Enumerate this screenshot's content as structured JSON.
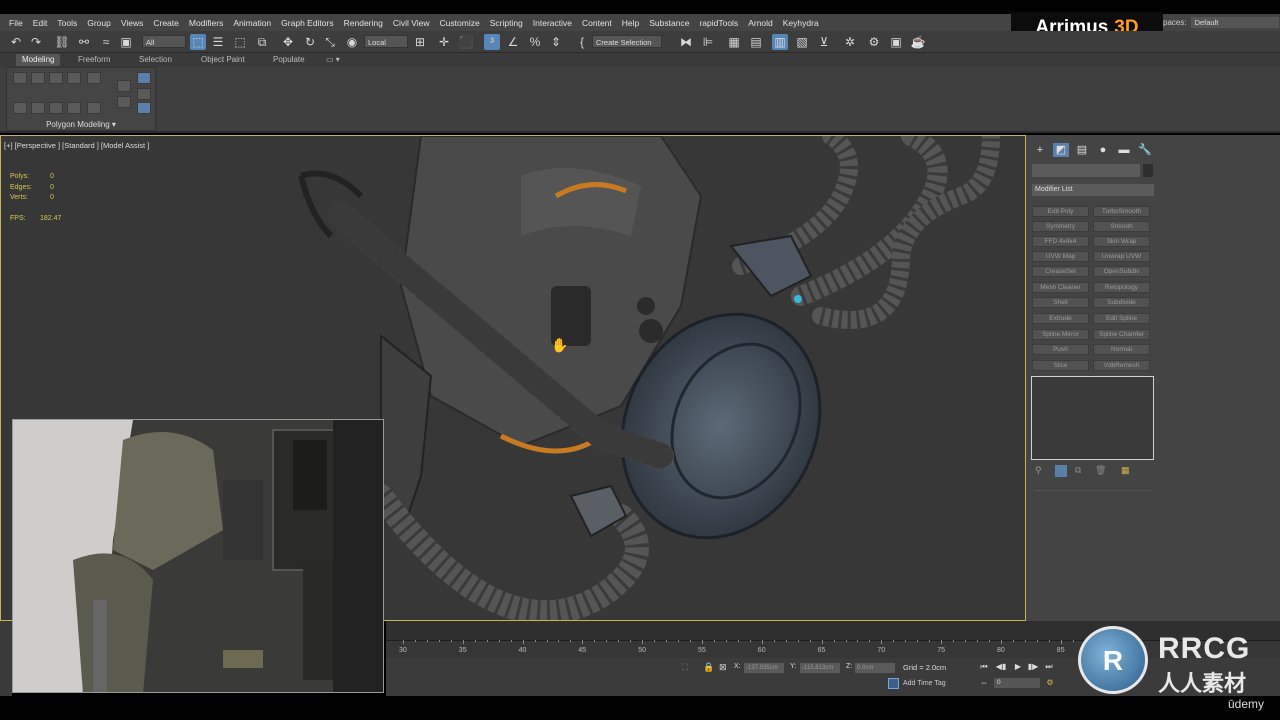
{
  "menu": [
    "File",
    "Edit",
    "Tools",
    "Group",
    "Views",
    "Create",
    "Modifiers",
    "Animation",
    "Graph Editors",
    "Rendering",
    "Civil View",
    "Customize",
    "Scripting",
    "Interactive",
    "Content",
    "Help",
    "Substance",
    "rapidTools",
    "Arnold",
    "Keyhydra"
  ],
  "brand": {
    "part1": "Arrimus",
    "part2": "3D"
  },
  "workspace": {
    "label": "paces:",
    "value": "Default"
  },
  "toolbar": {
    "filter": "All",
    "coord": "Local",
    "selection_set": "Create Selection Se"
  },
  "ribbon": {
    "tabs": [
      "Modeling",
      "Freeform",
      "Selection",
      "Object Paint",
      "Populate"
    ],
    "panel_label": "Polygon Modeling ▾"
  },
  "viewport": {
    "label": "[+] [Perspective ] [Standard ] [Model Assist ]",
    "stats": [
      {
        "k": "Polys:",
        "v": "0"
      },
      {
        "k": "Edges:",
        "v": "0"
      },
      {
        "k": "Verts:",
        "v": "0"
      }
    ],
    "fps_label": "FPS:",
    "fps": "182.47"
  },
  "command_panel": {
    "modifier_list": "Modifier List",
    "buttons": [
      "Edit Poly",
      "TurboSmooth",
      "Symmetry",
      "Smooth",
      "FFD 4x4x4",
      "Skin Wrap",
      "UVW Map",
      "Unwrap UVW",
      "CreaseSet",
      "OpenSubdiv",
      "Mesh Cleaner",
      "Retopology",
      "Shell",
      "Subdivide",
      "Extrude",
      "Edit Spline",
      "Spline Mirror",
      "Spline Chamfer",
      "Push",
      "Normal",
      "Slice",
      "VdbRemesh"
    ]
  },
  "timeline": {
    "ticks": [
      "30",
      "35",
      "40",
      "45",
      "50",
      "55",
      "60",
      "65",
      "70",
      "75",
      "80",
      "85"
    ]
  },
  "status": {
    "x_label": "X:",
    "x_val": "-137.935cm",
    "y_label": "Y:",
    "y_val": "-115.813cm",
    "z_label": "Z:",
    "z_val": "0.0cm",
    "grid": "Grid = 2.0cm",
    "add_time_tag": "Add Time Tag",
    "frame": "0"
  },
  "watermark": {
    "logo": "RRCG",
    "sub": "人人素材",
    "udemy": "ūdemy"
  },
  "colors": {
    "accent": "#5687b8",
    "viewport_border": "#c9b354",
    "stats": "#d7c84a",
    "brand_orange": "#ff9a1f"
  }
}
